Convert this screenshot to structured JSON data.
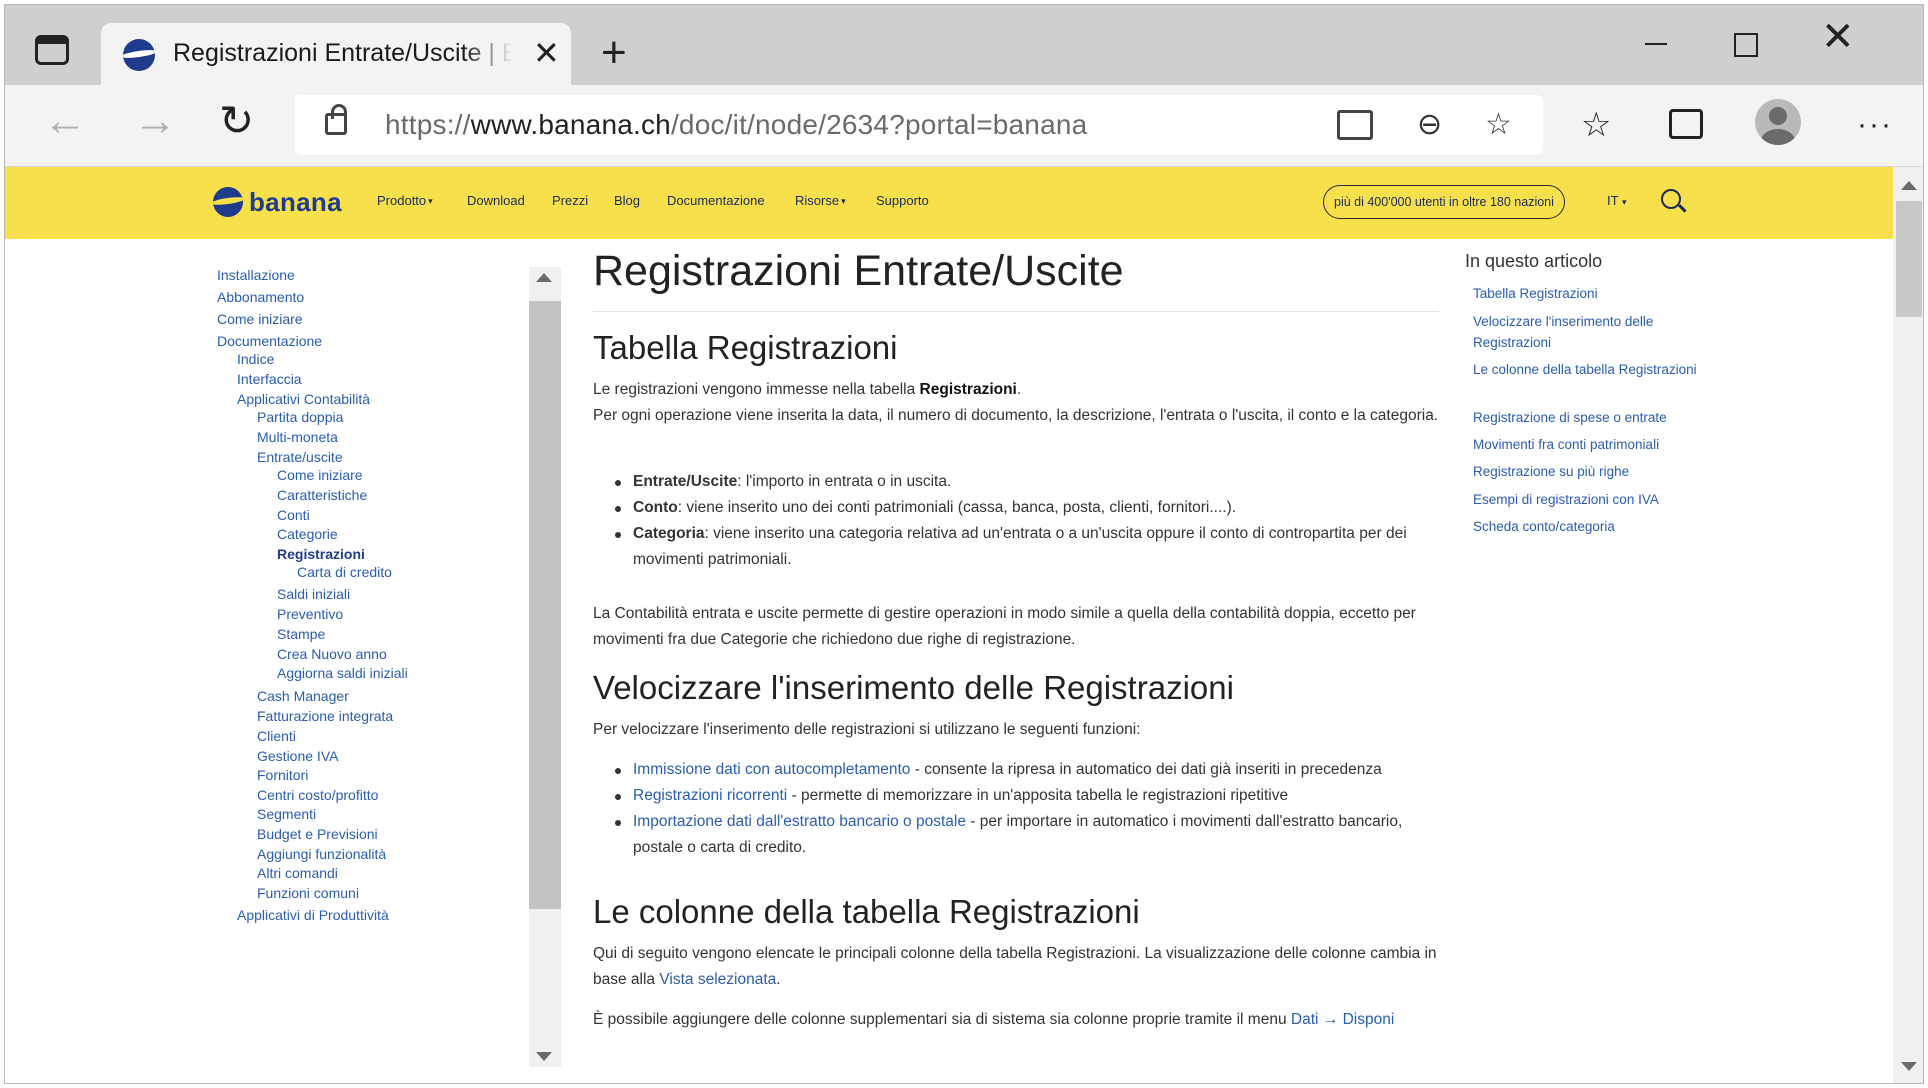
{
  "browser": {
    "tab_title": "Registrazioni Entrate/Uscite | Banana",
    "tab_close": "✕",
    "new_tab": "+",
    "url_prefix": "https://",
    "url_host": "www.banana.ch",
    "url_path": "/doc/it/node/2634?portal=banana",
    "back": "←",
    "forward": "→",
    "reload": "↻",
    "zoom": "⊖",
    "fav_add": "☆",
    "favorites": "☆",
    "more": "···",
    "close": "✕"
  },
  "site": {
    "logo_text": "banana",
    "nav": [
      {
        "label": "Prodotto",
        "caret": "▾"
      },
      {
        "label": "Download"
      },
      {
        "label": "Prezzi"
      },
      {
        "label": "Blog"
      },
      {
        "label": "Documentazione"
      },
      {
        "label": "Risorse",
        "caret": "▾"
      },
      {
        "label": "Supporto"
      }
    ],
    "users_badge": "più di 400'000 utenti in oltre 180 nazioni",
    "lang": "IT",
    "lang_caret": "▾"
  },
  "leftnav": [
    {
      "label": "Installazione"
    },
    {
      "label": "Abbonamento"
    },
    {
      "label": "Come iniziare"
    },
    {
      "label": "Documentazione"
    },
    {
      "label": "Indice"
    },
    {
      "label": "Interfaccia"
    },
    {
      "label": "Applicativi Contabilità"
    },
    {
      "label": "Partita doppia"
    },
    {
      "label": "Multi-moneta"
    },
    {
      "label": "Entrate/uscite"
    },
    {
      "label": "Come iniziare"
    },
    {
      "label": "Caratteristiche"
    },
    {
      "label": "Conti"
    },
    {
      "label": "Categorie"
    },
    {
      "label": "Registrazioni"
    },
    {
      "label": "Carta di credito"
    },
    {
      "label": "Saldi iniziali"
    },
    {
      "label": "Preventivo"
    },
    {
      "label": "Stampe"
    },
    {
      "label": "Crea Nuovo anno"
    },
    {
      "label": "Aggiorna saldi iniziali"
    },
    {
      "label": "Cash Manager"
    },
    {
      "label": "Fatturazione integrata"
    },
    {
      "label": "Clienti"
    },
    {
      "label": "Gestione IVA"
    },
    {
      "label": "Fornitori"
    },
    {
      "label": "Centri costo/profitto"
    },
    {
      "label": "Segmenti"
    },
    {
      "label": "Budget e Previsioni"
    },
    {
      "label": "Aggiungi funzionalità"
    },
    {
      "label": "Altri comandi"
    },
    {
      "label": "Funzioni comuni"
    },
    {
      "label": "Applicativi di Produttività"
    }
  ],
  "article": {
    "title": "Registrazioni Entrate/Uscite",
    "s1_title": "Tabella Registrazioni",
    "s1_p1_a": "Le registrazioni vengono immesse nella tabella ",
    "s1_p1_b": "Registrazioni",
    "s1_p1_c": ".",
    "s1_p2": "Per ogni operazione viene inserita la data, il numero di documento, la descrizione, l'entrata o l'uscita, il conto e la categoria.",
    "s1_li1_b": "Entrate/Uscite",
    "s1_li1": ": l'importo in entrata o in uscita.",
    "s1_li2_b": "Conto",
    "s1_li2": ": viene inserito uno dei conti patrimoniali (cassa, banca, posta, clienti, fornitori....).",
    "s1_li3_b": "Categoria",
    "s1_li3": ": viene inserito una categoria relativa ad un'entrata o a un'uscita oppure il conto di contropartita per dei movimenti patrimoniali.",
    "s1_p3": "La Contabilità entrata e uscite permette di gestire operazioni in modo simile a quella della contabilità doppia, eccetto per movimenti fra due Categorie che richiedono  due righe di registrazione.",
    "s2_title": "Velocizzare l'inserimento delle Registrazioni",
    "s2_p1": "Per velocizzare l'inserimento delle registrazioni si utilizzano le seguenti funzioni:",
    "s2_li1_a": "Immissione dati con autocompletamento",
    "s2_li1": " - consente la ripresa in automatico dei dati già inseriti in precedenza",
    "s2_li2_a": "Registrazioni ricorrenti",
    "s2_li2": " - permette di memorizzare in un'apposita tabella le registrazioni ripetitive",
    "s2_li3_a": "Importazione dati dall'estratto bancario o postale",
    "s2_li3": " - per importare in automatico i movimenti dall'estratto bancario, postale o carta di credito.",
    "s3_title": "Le colonne della tabella Registrazioni",
    "s3_p1": "Qui di seguito vengono elencate le principali colonne della tabella Registrazioni. La visualizzazione delle colonne cambia in base alla ",
    "s3_p1_a": "Vista selezionata",
    "s3_p1_c": ".",
    "s3_p2": "È possibile aggiungere delle colonne supplementari sia di sistema sia colonne proprie tramite il menu ",
    "s3_p2_a": "Dati → Disponi"
  },
  "toc": {
    "title": "In questo articolo",
    "items": [
      "Tabella Registrazioni",
      "Velocizzare l'inserimento delle Registrazioni",
      "Le colonne della tabella Registrazioni",
      "Registrazione di spese o entrate",
      "Movimenti fra conti patrimoniali",
      "Registrazione su più righe",
      "Esempi di registrazioni con IVA",
      "Scheda conto/categoria"
    ]
  },
  "colors": {
    "header_yellow": "#f7e04b",
    "brand_blue": "#1f3b8c",
    "link_blue": "#2a5cb0"
  }
}
